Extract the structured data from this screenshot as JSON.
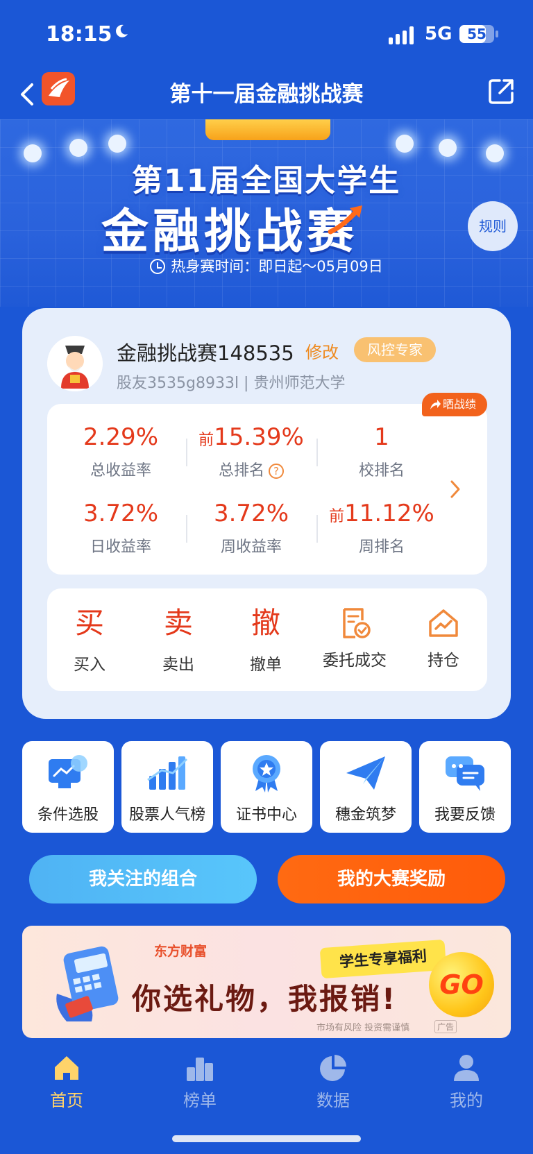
{
  "status_bar": {
    "time": "18:15",
    "network": "5G",
    "battery": "55"
  },
  "nav": {
    "title": "第十一届金融挑战赛"
  },
  "hero": {
    "line1": "第11届全国大学生",
    "line2": "金融挑战赛",
    "rules_label": "规则",
    "warmup_time": "热身赛时间：即日起～05月09日"
  },
  "profile": {
    "name": "金融挑战赛148535",
    "edit_label": "修改",
    "badge": "风控专家",
    "subtitle": "股友3535g8933l | 贵州师范大学",
    "share_label": "晒战绩"
  },
  "stats": {
    "total_return": {
      "value": "2.29%",
      "label": "总收益率"
    },
    "total_rank": {
      "prefix": "前",
      "value": "15.39%",
      "label": "总排名"
    },
    "school_rank": {
      "value": "1",
      "label": "校排名"
    },
    "daily_return": {
      "value": "3.72%",
      "label": "日收益率"
    },
    "weekly_return": {
      "value": "3.72%",
      "label": "周收益率"
    },
    "weekly_rank": {
      "prefix": "前",
      "value": "11.12%",
      "label": "周排名"
    }
  },
  "actions": {
    "buy": {
      "glyph": "买",
      "label": "买入"
    },
    "sell": {
      "glyph": "卖",
      "label": "卖出"
    },
    "cancel": {
      "glyph": "撤",
      "label": "撤单"
    },
    "orders": {
      "label": "委托成交",
      "icon": "document-check-icon"
    },
    "holdings": {
      "label": "持仓",
      "icon": "house-chart-icon"
    }
  },
  "tools": [
    {
      "label": "条件选股",
      "icon": "monitor-chart-icon"
    },
    {
      "label": "股票人气榜",
      "icon": "bar-chart-icon"
    },
    {
      "label": "证书中心",
      "icon": "medal-icon"
    },
    {
      "label": "穗金筑梦",
      "icon": "paper-plane-icon"
    },
    {
      "label": "我要反馈",
      "icon": "chat-bubble-icon"
    }
  ],
  "buttons": {
    "follow": "我关注的组合",
    "reward": "我的大赛奖励"
  },
  "ad": {
    "brand": "东方财富",
    "tag_line": "学生专享福利",
    "headline": "你选礼物，我报销!",
    "go_label": "GO",
    "disclaimer": "市场有风险 投资需谨慎",
    "ad_tag": "广告"
  },
  "tabbar": [
    {
      "label": "首页",
      "icon": "home-icon",
      "active": true
    },
    {
      "label": "榜单",
      "icon": "podium-icon",
      "active": false
    },
    {
      "label": "数据",
      "icon": "pie-chart-icon",
      "active": false
    },
    {
      "label": "我的",
      "icon": "user-icon",
      "active": false
    }
  ],
  "colors": {
    "primary": "#1b57d6",
    "accent_red": "#e4391b",
    "accent_orange": "#ff5b0a",
    "active_tab": "#ffd36a"
  }
}
